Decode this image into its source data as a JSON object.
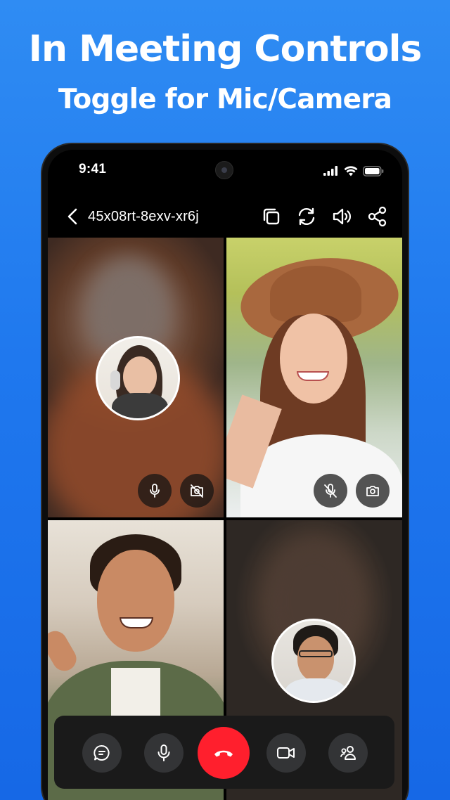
{
  "promo": {
    "headline": "In Meeting Controls",
    "subheadline": "Toggle for Mic/Camera"
  },
  "status_bar": {
    "time": "9:41",
    "icons": [
      "signal-icon",
      "wifi-icon",
      "battery-icon"
    ]
  },
  "header": {
    "meeting_id": "45x08rt-8exv-xr6j",
    "actions": [
      "copy-icon",
      "switch-camera-icon",
      "speaker-icon",
      "share-icon"
    ]
  },
  "participants": [
    {
      "tile": "top-left",
      "video": "blurred",
      "mic": "on",
      "camera": "off",
      "has_avatar": true
    },
    {
      "tile": "top-right",
      "video": "live",
      "mic": "muted",
      "camera": "on",
      "has_avatar": false
    },
    {
      "tile": "bottom-left",
      "video": "live",
      "has_avatar": false
    },
    {
      "tile": "bottom-right",
      "video": "blurred",
      "has_avatar": true
    }
  ],
  "controls": [
    "chat-icon",
    "mic-icon",
    "end-call-icon",
    "video-icon",
    "participants-icon"
  ],
  "colors": {
    "background": "#1f78ee",
    "end_call": "#ff1f2d",
    "control_bar": "#1a1a1a",
    "control_button": "#333436"
  }
}
